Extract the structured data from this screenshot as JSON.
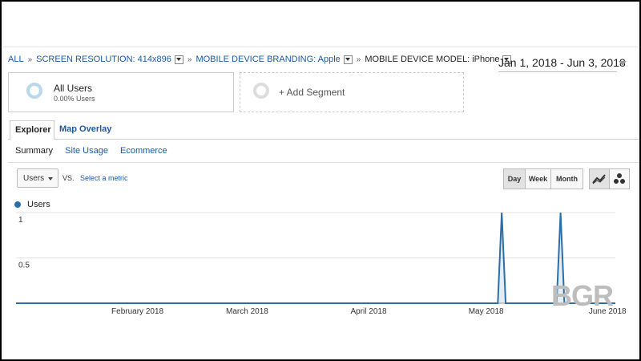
{
  "breadcrumb": {
    "all": "ALL",
    "screen_resolution": "SCREEN RESOLUTION: 414x896",
    "device_branding": "MOBILE DEVICE BRANDING: Apple",
    "device_model": "MOBILE DEVICE MODEL: iPhone"
  },
  "date_range": "Jan 1, 2018 - Jun 3, 2018",
  "segments": {
    "all_users_title": "All Users",
    "all_users_sub": "0.00% Users",
    "add_segment": "+ Add Segment"
  },
  "tabs": {
    "explorer": "Explorer",
    "map_overlay": "Map Overlay"
  },
  "subtabs": {
    "summary": "Summary",
    "site_usage": "Site Usage",
    "ecommerce": "Ecommerce"
  },
  "metric": {
    "selected": "Users",
    "vs": "VS.",
    "select_metric": "Select a metric"
  },
  "granularity": {
    "day": "Day",
    "week": "Week",
    "month": "Month",
    "active": "Day"
  },
  "legend": {
    "users": "Users"
  },
  "watermark": "BGR",
  "colors": {
    "series": "#2c6ea8",
    "link": "#1a5aa8"
  },
  "chart_data": {
    "type": "line",
    "series": [
      {
        "name": "Users",
        "x": [
          "2018-01-01",
          "2018-05-04",
          "2018-05-05",
          "2018-05-06",
          "2018-05-19",
          "2018-05-20",
          "2018-05-21",
          "2018-06-03"
        ],
        "values": [
          0,
          0,
          1,
          0,
          0,
          1,
          0,
          0
        ]
      }
    ],
    "xlim": [
      "2018-01-01",
      "2018-06-03"
    ],
    "x_ticks": [
      {
        "label": "February 2018",
        "date": "2018-02-01"
      },
      {
        "label": "March 2018",
        "date": "2018-03-01"
      },
      {
        "label": "April 2018",
        "date": "2018-04-01"
      },
      {
        "label": "May 2018",
        "date": "2018-05-01"
      },
      {
        "label": "June 2018",
        "date": "2018-06-01"
      }
    ],
    "y_ticks": [
      "1",
      "0.5"
    ],
    "ylim": [
      0,
      1
    ],
    "grid": true
  }
}
